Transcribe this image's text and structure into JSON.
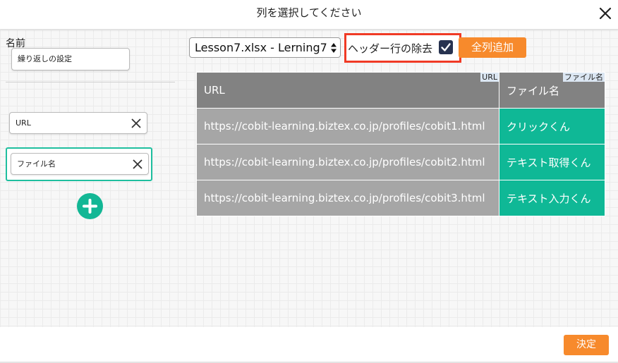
{
  "dialog": {
    "title": "列を選択してください",
    "close_icon": "close-icon"
  },
  "left_panel": {
    "name_label": "名前",
    "name_value": "繰り返しの設定",
    "columns": [
      {
        "label": "URL",
        "selected": false
      },
      {
        "label": "ファイル名",
        "selected": true
      }
    ],
    "add_icon": "plus-circle-icon"
  },
  "toolbar": {
    "file_select_value": "Lesson7.xlsx - Lerning7",
    "header_remove_label": "ヘッダー行の除去",
    "header_remove_checked": true,
    "add_all_label": "全列追加"
  },
  "table": {
    "headers": [
      {
        "text": "URL",
        "tag": "URL"
      },
      {
        "text": "ファイル名",
        "tag": "ファイル名"
      }
    ],
    "rows": [
      [
        "https://cobit-learning.biztex.co.jp/profiles/cobit1.html",
        "クリックくん"
      ],
      [
        "https://cobit-learning.biztex.co.jp/profiles/cobit2.html",
        "テキスト取得くん"
      ],
      [
        "https://cobit-learning.biztex.co.jp/profiles/cobit3.html",
        "テキスト入力くん"
      ]
    ]
  },
  "footer": {
    "decide_label": "決定"
  },
  "colors": {
    "accent_orange": "#f78a2c",
    "teal": "#13b795",
    "highlight_red": "#f03a25",
    "checkbox_navy": "#27324f"
  }
}
